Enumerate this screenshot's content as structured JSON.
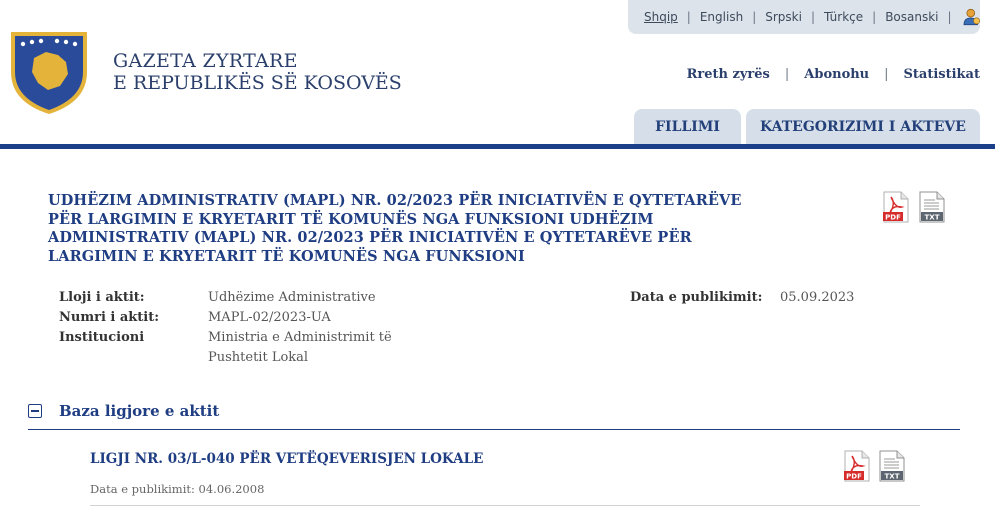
{
  "languages": [
    {
      "label": "Shqip",
      "active": true
    },
    {
      "label": "English",
      "active": false
    },
    {
      "label": "Srpski",
      "active": false
    },
    {
      "label": "Türkçe",
      "active": false
    },
    {
      "label": "Bosanski",
      "active": false
    }
  ],
  "header": {
    "title_line1": "GAZETA ZYRTARE",
    "title_line2": "E REPUBLIKËS SË KOSOVËS",
    "logo_icon": "kosovo-coat-of-arms-icon",
    "user_icon": "user-login-icon"
  },
  "topnav": {
    "about": "Rreth zyrës",
    "subscribe": "Abonohu",
    "statistics": "Statistikat"
  },
  "tabs": {
    "home": "FILLIMI",
    "categorization": "KATEGORIZIMI I AKTEVE"
  },
  "act": {
    "title": "UDHËZIM ADMINISTRATIV (MAPL) NR. 02/2023 PËR INICIATIVËN E QYTETARËVE PËR LARGIMIN E KRYETARIT TË KOMUNËS NGA FUNKSIONI UDHËZIM ADMINISTRATIV (MAPL) NR. 02/2023 PËR INICIATIVËN E QYTETARËVE PËR LARGIMIN E KRYETARIT TË KOMUNËS NGA FUNKSIONI",
    "type_label": "Lloji i aktit:",
    "type_value": "Udhëzime Administrative",
    "number_label": "Numri i aktit:",
    "number_value": "MAPL-02/2023-UA",
    "institution_label": "Institucioni",
    "institution_value_line1": "Ministria e Administrimit të",
    "institution_value_line2": "Pushtetit Lokal",
    "pub_date_label": "Data e publikimit:",
    "pub_date_value": "05.09.2023",
    "pdf_label": "PDF",
    "txt_label": "TXT"
  },
  "legal_basis": {
    "section_title": "Baza ligjore e aktit",
    "law_title": "LIGJI NR. 03/L-040 PËR VETËQEVERISJEN LOKALE",
    "law_date": "Data e publikimit: 04.06.2008",
    "pdf_label": "PDF",
    "txt_label": "TXT"
  },
  "colors": {
    "brand_blue": "#1f3d82",
    "tab_bg": "#d6dfe9",
    "lang_bar_bg": "#dde3ea",
    "pdf_red": "#d62b2b"
  }
}
